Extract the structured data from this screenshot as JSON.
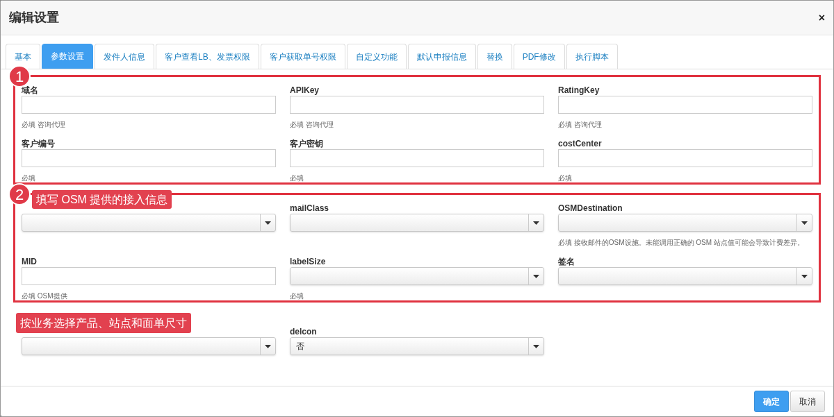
{
  "dialog": {
    "title": "编辑设置",
    "close": "×"
  },
  "tabs": [
    {
      "label": "基本",
      "selected": false
    },
    {
      "label": "参数设置",
      "selected": true
    },
    {
      "label": "发件人信息",
      "selected": false
    },
    {
      "label": "客户查看LB、发票权限",
      "selected": false
    },
    {
      "label": "客户获取单号权限",
      "selected": false
    },
    {
      "label": "自定义功能",
      "selected": false
    },
    {
      "label": "默认申报信息",
      "selected": false
    },
    {
      "label": "替换",
      "selected": false
    },
    {
      "label": "PDF修改",
      "selected": false
    },
    {
      "label": "执行脚本",
      "selected": false
    }
  ],
  "groups": [
    {
      "boxed": true,
      "badge": "1",
      "rows": [
        [
          {
            "kind": "text",
            "label": "域名",
            "hint": "必填 咨询代理"
          },
          {
            "kind": "text",
            "label": "APIKey",
            "hint": "必填 咨询代理"
          },
          {
            "kind": "text",
            "label": "RatingKey",
            "hint": "必填 咨询代理"
          }
        ],
        [
          {
            "kind": "text",
            "label": "客户编号",
            "hint": "必填"
          },
          {
            "kind": "text",
            "label": "客户密钥",
            "hint": "必填"
          },
          {
            "kind": "text",
            "label": "costCenter",
            "hint": "必填"
          }
        ]
      ]
    },
    {
      "boxed": true,
      "badge": "2",
      "callout": "填写 OSM 提供的接入信息",
      "rows": [
        [
          {
            "kind": "select"
          },
          {
            "kind": "select",
            "label": "mailClass"
          },
          {
            "kind": "select",
            "label": "OSMDestination",
            "hint": "必填 接收邮件的OSM设施。未能调用正确的 OSM 站点值可能会导致计费差异。"
          }
        ],
        [
          {
            "kind": "text",
            "label": "MID",
            "hint": "必填 OSM提供"
          },
          {
            "kind": "select",
            "label": "labelSize",
            "hint": "必填"
          },
          {
            "kind": "select",
            "label": "签名"
          }
        ]
      ]
    },
    {
      "boxed": false,
      "callout": "按业务选择产品、站点和面单尺寸",
      "rows": [
        [
          {
            "kind": "select"
          },
          {
            "kind": "select",
            "label": "delcon",
            "value": "否"
          }
        ]
      ]
    }
  ],
  "buttons": [
    {
      "label": "确定",
      "primary": true
    },
    {
      "label": "取消",
      "primary": false
    }
  ]
}
